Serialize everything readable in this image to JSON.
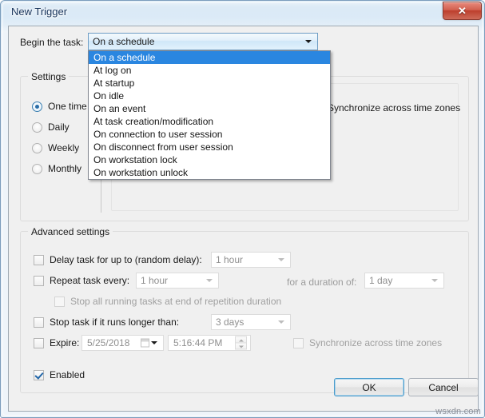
{
  "window": {
    "title": "New Trigger",
    "close_icon": "close-icon",
    "close_label": "✕"
  },
  "begin": {
    "label": "Begin the task:",
    "selected": "On a schedule",
    "options": [
      "On a schedule",
      "At log on",
      "At startup",
      "On idle",
      "On an event",
      "At task creation/modification",
      "On connection to user session",
      "On disconnect from user session",
      "On workstation lock",
      "On workstation unlock"
    ]
  },
  "settings": {
    "caption": "Settings",
    "radios": [
      {
        "label": "One time",
        "checked": true
      },
      {
        "label": "Daily",
        "checked": false
      },
      {
        "label": "Weekly",
        "checked": false
      },
      {
        "label": "Monthly",
        "checked": false
      }
    ],
    "sync_across_time_zones": "Synchronize across time zones"
  },
  "advanced": {
    "caption": "Advanced settings",
    "delay_task_label": "Delay task for up to (random delay):",
    "delay_task_value": "1 hour",
    "repeat_task_label": "Repeat task every:",
    "repeat_task_value": "1 hour",
    "duration_label": "for a duration of:",
    "duration_value": "1 day",
    "stop_all_label": "Stop all running tasks at end of repetition duration",
    "stop_task_label": "Stop task if it runs longer than:",
    "stop_task_value": "3 days",
    "expire_label": "Expire:",
    "expire_date": "5/25/2018",
    "expire_time": "5:16:44 PM",
    "sync_time_zones_label": "Synchronize across time zones",
    "enabled_label": "Enabled"
  },
  "buttons": {
    "ok": "OK",
    "cancel": "Cancel"
  },
  "watermark": "wsxdn.com"
}
